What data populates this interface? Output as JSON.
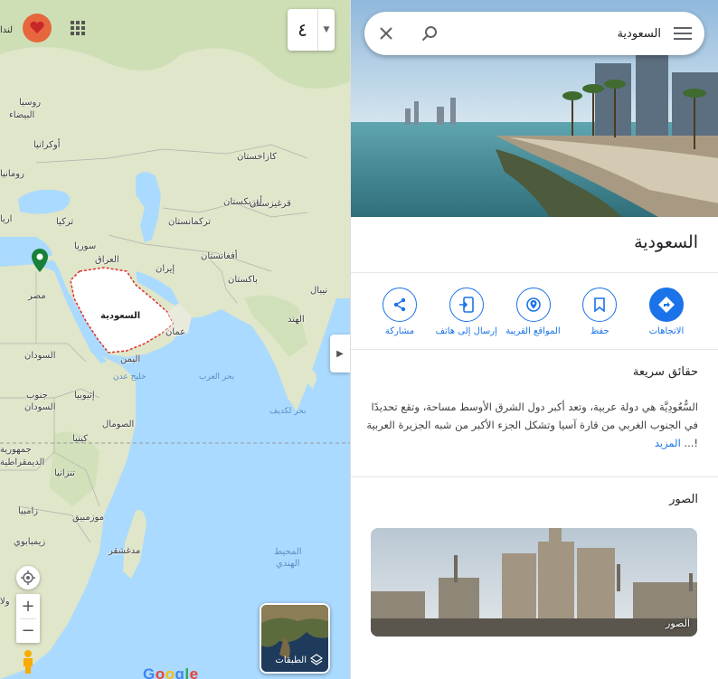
{
  "map": {
    "partial_label": "لندا",
    "lang_toggle": "٤",
    "countries": {
      "kazakhstan": "كازاخستان",
      "uzbekistan": "أوزبكستان",
      "kyrgyzstan": "قرغيزستان",
      "turkmenistan": "تركمانستان",
      "turkey": "تركيا",
      "syria": "سوريا",
      "iraq": "العراق",
      "iran": "إيران",
      "afghanistan": "أفغانستان",
      "pakistan": "باكستان",
      "nepal": "نيبال",
      "india": "الهند",
      "egypt": "مصر",
      "saudi": "السعودية",
      "oman": "عمان",
      "yemen": "اليمن",
      "sudan": "السودان",
      "south_sudan_1": "جنوب",
      "south_sudan_2": "السودان",
      "ethiopia": "إثيوبيا",
      "somalia": "الصومال",
      "kenya": "كينيا",
      "tanzania": "تنزانيا",
      "zambia": "زامبيا",
      "mozambique": "موزمبيق",
      "zimbabwe": "زيمبابوي",
      "madagascar": "مدغشقر",
      "russia": "روسيا",
      "belarus": "البيضاء",
      "ukraine": "أوكرانيا",
      "romania": "رومانيا",
      "drc_1": "جمهورية",
      "drc_2": "الديمقراطية",
      "bulgaria": "اريا",
      "angola": "ولا"
    },
    "seas": {
      "arabian_sea": "بحر العرب",
      "gulf_aden": "خليج عدن",
      "laccadive": "بحر لكديف",
      "indian_ocean_1": "المحيط",
      "indian_ocean_2": "الهندي"
    },
    "layers_label": "الطبقات",
    "google_logo": "Google"
  },
  "panel": {
    "search": {
      "value": "السعودية",
      "placeholder": ""
    },
    "place_title": "السعودية",
    "actions": [
      {
        "label": "الاتجاهات",
        "icon": "directions-icon"
      },
      {
        "label": "حفظ",
        "icon": "bookmark-icon"
      },
      {
        "label": "المواقع القريبة",
        "icon": "nearby-icon"
      },
      {
        "label": "إرسال إلى هاتف",
        "icon": "send-to-phone-icon"
      },
      {
        "label": "مشاركة",
        "icon": "share-icon"
      }
    ],
    "facts_title": "حقائق سريعة",
    "facts_text": "السُّعُودِيَّة هي دولة عربية، وتعد أكبر دول الشرق الأوسط مساحة، وتقع تحديدًا في الجنوب الغربي من قارة آسيا وتشكل الجزء الأكبر من شبه الجزيرة العربية !... ",
    "facts_more": "المزيد",
    "photos_title": "الصور",
    "photo_caption": "الصور"
  },
  "colors": {
    "accent": "#1a73e8",
    "water": "#aadaff",
    "land": "#e8eadb",
    "selected_region": "#ffffff",
    "border_highlight": "#e0302a"
  }
}
